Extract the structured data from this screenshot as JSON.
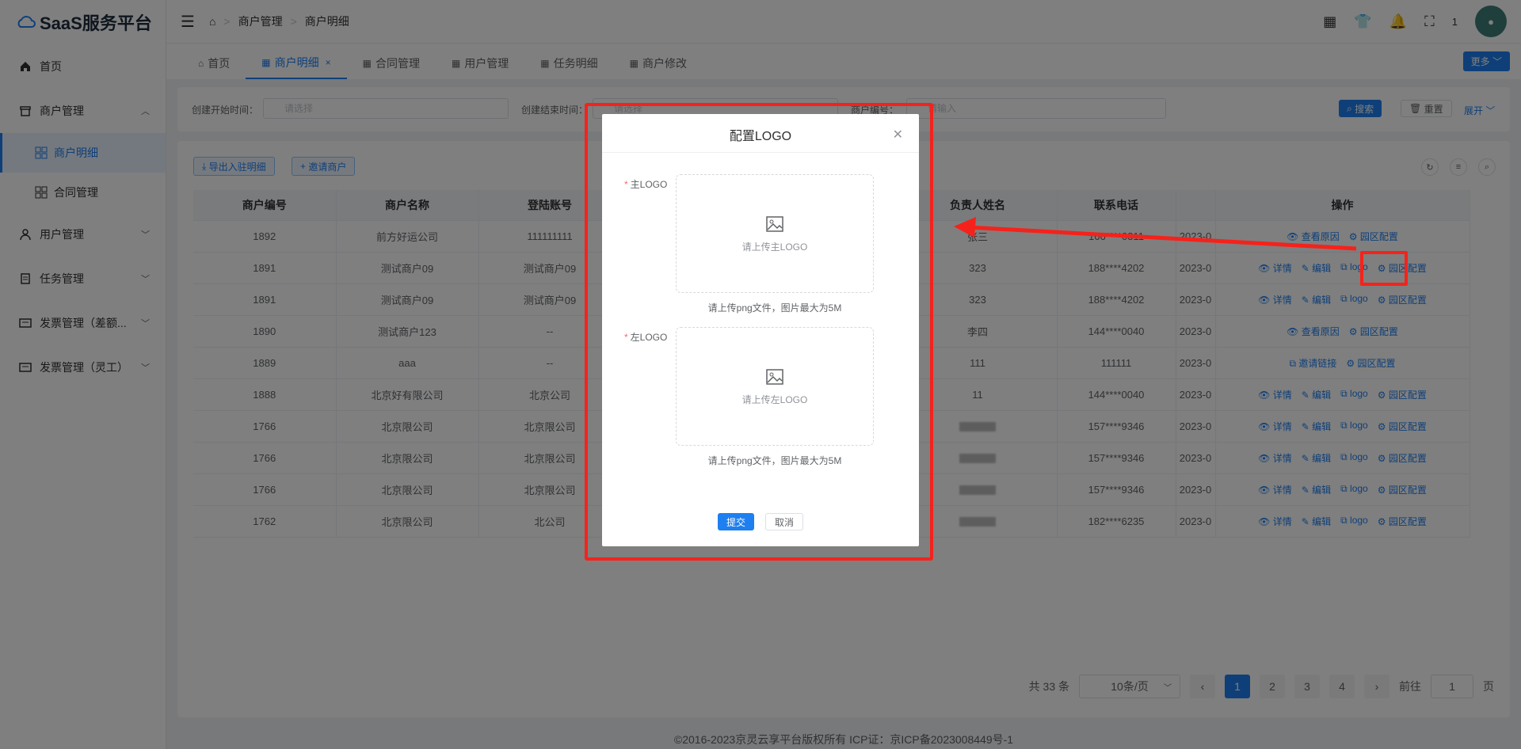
{
  "app": {
    "logo_text": "SaaS服务平台"
  },
  "sidebar": {
    "items": [
      {
        "label": "首页",
        "icon": "home-icon"
      },
      {
        "label": "商户管理",
        "icon": "shop-icon",
        "expanded": true
      },
      {
        "label": "用户管理",
        "icon": "user-icon"
      },
      {
        "label": "任务管理",
        "icon": "task-icon"
      },
      {
        "label": "发票管理（差额...",
        "icon": "invoice-icon"
      },
      {
        "label": "发票管理（灵工）",
        "icon": "invoice-icon"
      }
    ],
    "subitems": [
      {
        "label": "商户明细",
        "active": true
      },
      {
        "label": "合同管理"
      }
    ]
  },
  "header": {
    "breadcrumb": [
      "商户管理",
      "商户明细"
    ],
    "user_count": "1"
  },
  "tabs": [
    {
      "label": "首页"
    },
    {
      "label": "商户明细",
      "active": true
    },
    {
      "label": "合同管理"
    },
    {
      "label": "用户管理"
    },
    {
      "label": "任务明细"
    },
    {
      "label": "商户修改"
    }
  ],
  "more_label": "更多",
  "filter": {
    "start_label": "创建开始时间：",
    "start_placeholder": "请选择",
    "end_label": "创建结束时间：",
    "end_placeholder": "请选择",
    "id_label": "商户编号：",
    "id_placeholder": "请输入",
    "search_label": "搜索",
    "reset_label": "重置",
    "expand_label": "展开"
  },
  "toolbar": {
    "export_label": "导出入驻明细",
    "invite_label": "邀请商户"
  },
  "table": {
    "columns": [
      "商户编号",
      "商户名称",
      "登陆账号",
      "负责人姓名",
      "联系电话",
      "",
      "操作"
    ],
    "rows": [
      {
        "id": "1892",
        "name": "前方好运公司",
        "account": "111111111",
        "owner": "张三",
        "phone": "166****0311",
        "date": "2023-0",
        "ops": [
          "查看原因",
          "园区配置"
        ]
      },
      {
        "id": "1891",
        "name": "测试商户09",
        "account": "测试商户09",
        "owner": "323",
        "phone": "188****4202",
        "date": "2023-0",
        "ops": [
          "详情",
          "编辑",
          "logo",
          "园区配置"
        ]
      },
      {
        "id": "1891",
        "name": "测试商户09",
        "account": "测试商户09",
        "owner": "323",
        "phone": "188****4202",
        "date": "2023-0",
        "ops": [
          "详情",
          "编辑",
          "logo",
          "园区配置"
        ]
      },
      {
        "id": "1890",
        "name": "测试商户123",
        "account": "--",
        "owner": "李四",
        "phone": "144****0040",
        "date": "2023-0",
        "ops": [
          "查看原因",
          "园区配置"
        ]
      },
      {
        "id": "1889",
        "name": "aaa",
        "account": "--",
        "owner": "111",
        "phone": "111111",
        "date": "2023-0",
        "ops": [
          "邀请链接",
          "园区配置"
        ]
      },
      {
        "id": "1888",
        "name": "北京好有限公司",
        "account": "北京公司",
        "owner": "11",
        "phone": "144****0040",
        "date": "2023-0",
        "ops": [
          "详情",
          "编辑",
          "logo",
          "园区配置"
        ]
      },
      {
        "id": "1766",
        "name": "北京限公司",
        "account": "北京限公司",
        "owner": "",
        "phone": "157****9346",
        "date": "2023-0",
        "ops": [
          "详情",
          "编辑",
          "logo",
          "园区配置"
        ]
      },
      {
        "id": "1766",
        "name": "北京限公司",
        "account": "北京限公司",
        "owner": "",
        "phone": "157****9346",
        "date": "2023-0",
        "ops": [
          "详情",
          "编辑",
          "logo",
          "园区配置"
        ]
      },
      {
        "id": "1766",
        "name": "北京限公司",
        "account": "北京限公司",
        "owner": "",
        "phone": "157****9346",
        "date": "2023-0",
        "ops": [
          "详情",
          "编辑",
          "logo",
          "园区配置"
        ]
      },
      {
        "id": "1762",
        "name": "北京限公司",
        "account": "北公司",
        "owner": "",
        "phone": "182****6235",
        "date": "2023-0",
        "ops": [
          "详情",
          "编辑",
          "logo",
          "园区配置"
        ]
      }
    ]
  },
  "pagination": {
    "total": "共 33 条",
    "page_size": "10条/页",
    "pages": [
      "1",
      "2",
      "3",
      "4"
    ],
    "current": "1",
    "goto_label": "前往",
    "goto_value": "1",
    "page_suffix": "页"
  },
  "footer": "©2016-2023京灵云享平台版权所有 ICP证：京ICP备2023008449号-1",
  "dialog": {
    "title": "配置LOGO",
    "main_label": "主LOGO",
    "main_upload_text": "请上传主LOGO",
    "main_tip": "请上传png文件，图片最大为5M",
    "left_label": "左LOGO",
    "left_upload_text": "请上传左LOGO",
    "left_tip": "请上传png文件，图片最大为5M",
    "submit_label": "提交",
    "cancel_label": "取消"
  },
  "colors": {
    "primary": "#1e7ff0",
    "annotation": "#f5221b"
  }
}
